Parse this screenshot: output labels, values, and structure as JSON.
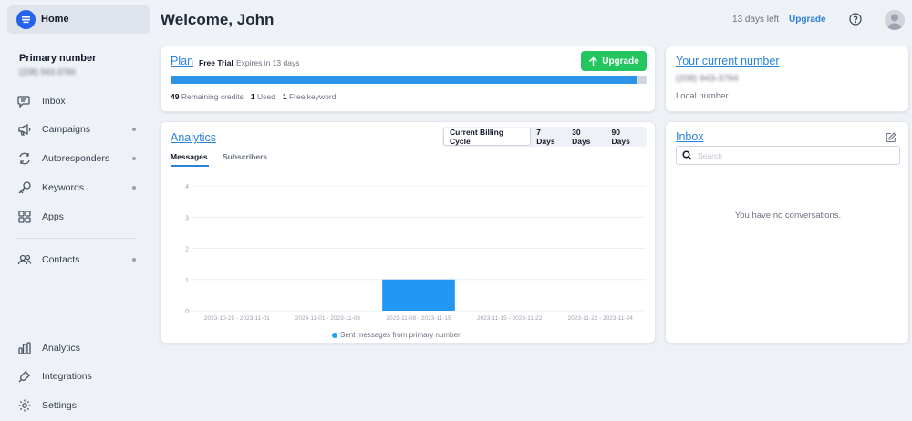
{
  "sidebar": {
    "home_label": "Home",
    "primary_label": "Primary number",
    "primary_number": "(208) 943-3784",
    "nav": [
      {
        "label": "Inbox",
        "icon": "chat-icon",
        "dot": false
      },
      {
        "label": "Campaigns",
        "icon": "megaphone-icon",
        "dot": true
      },
      {
        "label": "Autoresponders",
        "icon": "refresh-icon",
        "dot": true
      },
      {
        "label": "Keywords",
        "icon": "key-icon",
        "dot": true
      },
      {
        "label": "Apps",
        "icon": "apps-grid-icon",
        "dot": false
      },
      {
        "label": "Contacts",
        "icon": "contacts-icon",
        "dot": true
      },
      {
        "label": "Analytics",
        "icon": "bar-chart-icon",
        "dot": false
      },
      {
        "label": "Integrations",
        "icon": "plug-icon",
        "dot": false
      },
      {
        "label": "Settings",
        "icon": "gear-icon",
        "dot": false
      }
    ]
  },
  "header": {
    "welcome": "Welcome, John",
    "days_left": "13 days left",
    "upgrade": "Upgrade"
  },
  "plan": {
    "title": "Plan",
    "tag": "Free Trial",
    "expires": "Expires in 13 days",
    "upgrade_button": "Upgrade",
    "progress_fraction": 0.98,
    "remaining_value": "49",
    "remaining_label": "Remaining credits",
    "used_value": "1",
    "used_label": "Used",
    "keyword_value": "1",
    "keyword_label": "Free keyword"
  },
  "number": {
    "title": "Your current number",
    "value": "(208) 943-3784",
    "type": "Local number"
  },
  "analytics": {
    "title": "Analytics",
    "ranges": [
      "Current Billing Cycle",
      "7 Days",
      "30 Days",
      "90 Days"
    ],
    "active_range": 0,
    "tabs": [
      "Messages",
      "Subscribers"
    ],
    "legend": "Sent messages from primary number"
  },
  "chart_data": {
    "type": "bar",
    "categories": [
      "2023-10-25 - 2023-11-01",
      "2023-11-01 - 2023-11-08",
      "2023-11-08 - 2023-11-15",
      "2023-11-15 - 2023-11-22",
      "2023-11-22 - 2023-11-24"
    ],
    "series": [
      {
        "name": "Sent messages from primary number",
        "values": [
          0,
          0,
          1,
          0,
          0
        ]
      }
    ],
    "y_ticks": [
      0,
      1,
      2,
      3,
      4
    ],
    "ylim": [
      0,
      4
    ],
    "grid": true,
    "legend_position": "bottom",
    "color": "#2196f3"
  },
  "inbox": {
    "title": "Inbox",
    "search_placeholder": "Search",
    "empty": "You have no conversations."
  },
  "colors": {
    "accent": "#2b82d9",
    "upgrade_green": "#22c55e",
    "progress_blue": "#2b94e9"
  }
}
